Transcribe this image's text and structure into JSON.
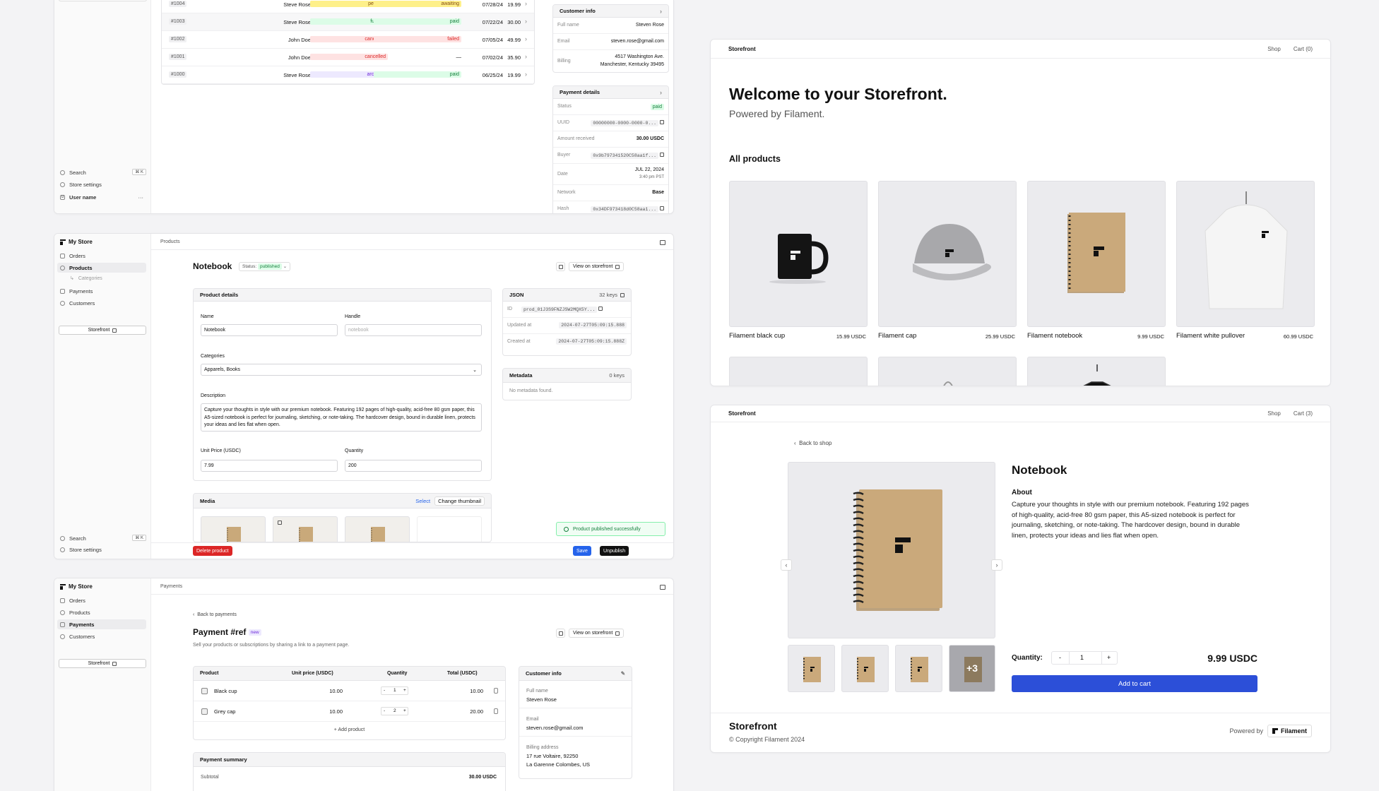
{
  "orders": {
    "rows": [
      {
        "id": "#1004",
        "customer": "Steve Rose",
        "status": "pending",
        "payment": "awaiting",
        "date": "07/28/24",
        "total": "19.99"
      },
      {
        "id": "#1003",
        "customer": "Steve Rose",
        "status": "fulfilled",
        "payment": "paid",
        "date": "07/22/24",
        "total": "30.00"
      },
      {
        "id": "#1002",
        "customer": "John Doe",
        "status": "cancelled",
        "payment": "failed",
        "date": "07/05/24",
        "total": "49.99"
      },
      {
        "id": "#1001",
        "customer": "John Doe",
        "status": "cancelled",
        "payment": "—",
        "date": "07/02/24",
        "total": "35.90"
      },
      {
        "id": "#1000",
        "customer": "Steve Rose",
        "status": "archived",
        "payment": "paid",
        "date": "06/25/24",
        "total": "19.99"
      }
    ],
    "sidebar": {
      "search": "Search",
      "shortcut": "⌘ K",
      "settings": "Store settings",
      "user": "User name",
      "user_initial": "U",
      "more": "···"
    },
    "customer": {
      "title": "Customer info",
      "full_name_label": "Full name",
      "full_name": "Steven Rose",
      "email_label": "Email",
      "email": "steven.rose@gmail.com",
      "billing_label": "Billing",
      "billing_1": "4517 Washington Ave.",
      "billing_2": "Manchester, Kentucky 39495"
    },
    "payment": {
      "title": "Payment details",
      "status_label": "Status",
      "status": "paid",
      "uuid_label": "UUID",
      "uuid": "00000000-0000-0000-0...",
      "amount_label": "Amount received",
      "amount": "30.00 USDC",
      "buyer_label": "Buyer",
      "buyer": "0x9b797341520C58aa1f...",
      "date_label": "Date",
      "date_1": "JUL 22, 2024",
      "date_2": "3:40 pm PST",
      "network_label": "Network",
      "network": "Base",
      "hash_label": "Hash",
      "hash": "0x34DF973418d0C58aa1..."
    }
  },
  "products_win": {
    "store": "My Store",
    "nav": [
      "Orders",
      "Products",
      "Categories",
      "Payments",
      "Customers"
    ],
    "storefront": "Storefront",
    "breadcrumb": "Products",
    "title": "Notebook",
    "status_label": "Status:",
    "status": "published",
    "view_storefront": "View on storefront",
    "details_title": "Product details",
    "name_label": "Name",
    "name": "Notebook",
    "handle_label": "Handle",
    "handle_placeholder": "notebook",
    "categories_label": "Categories",
    "categories": "Apparels, Books",
    "description_label": "Description",
    "description": "Capture your thoughts in style with our premium notebook. Featuring 192 pages of high-quality, acid-free 80 gsm paper, this A5-sized notebook is perfect for journaling, sketching, or note-taking. The hardcover design, bound in durable linen, protects your ideas and lies flat when open.",
    "price_label": "Unit Price (USDC)",
    "price": "7.99",
    "qty_label": "Quantity",
    "qty": "200",
    "json_title": "JSON",
    "json_keys": "32 keys",
    "id_label": "ID",
    "id": "prod_01J3S9FNZJSW2MQX5Y...",
    "updated_label": "Updated at",
    "updated": "2024-07-27T05:09:15.888",
    "created_label": "Created at",
    "created": "2024-07-27T05:09:15.888Z",
    "meta_title": "Metadata",
    "meta_keys": "0 keys",
    "meta_empty": "No metadata found.",
    "media_title": "Media",
    "select": "Select",
    "change_thumb": "Change thumbnail",
    "toast": "Product published successfully",
    "search": "Search",
    "shortcut": "⌘ K",
    "settings": "Store settings",
    "delete": "Delete product",
    "save": "Save",
    "unpublish": "Unpublish"
  },
  "payments_win": {
    "store": "My Store",
    "nav": [
      "Orders",
      "Products",
      "Payments",
      "Customers"
    ],
    "storefront": "Storefront",
    "breadcrumb": "Payments",
    "back": "Back to payments",
    "title": "Payment #ref",
    "badge": "new",
    "subtitle": "Sell your products or subscriptions by sharing a link to a payment page.",
    "view_storefront": "View on storefront",
    "cols": [
      "Product",
      "Unit price (USDC)",
      "Quantity",
      "Total (USDC)"
    ],
    "items": [
      {
        "name": "Black cup",
        "price": "10.00",
        "qty": "1",
        "total": "10.00"
      },
      {
        "name": "Grey cap",
        "price": "10.00",
        "qty": "2",
        "total": "20.00"
      }
    ],
    "add_product": "Add product",
    "summary_title": "Payment summary",
    "subtotal_label": "Subtotal",
    "subtotal": "30.00 USDC",
    "customer_title": "Customer info",
    "full_name_label": "Full name",
    "full_name": "Steven Rose",
    "email_label": "Email",
    "email": "steven.rose@gmail.com",
    "billing_label": "Billing address",
    "billing_1": "17 rue Voltaire, 92250",
    "billing_2": "La Garenne Colombes, US"
  },
  "shop": {
    "brand": "Storefront",
    "nav_shop": "Shop",
    "cart": "Cart (0)",
    "heading": "Welcome to your Storefront.",
    "sub": "Powered by Filament.",
    "section": "All products",
    "products": [
      {
        "name": "Filament black cup",
        "price": "15.99 USDC"
      },
      {
        "name": "Filament cap",
        "price": "25.99 USDC"
      },
      {
        "name": "Filament notebook",
        "price": "9.99 USDC"
      },
      {
        "name": "Filament white pullover",
        "price": "60.99 USDC"
      }
    ]
  },
  "pdp": {
    "brand": "Storefront",
    "nav_shop": "Shop",
    "cart": "Cart (3)",
    "back": "Back to shop",
    "title": "Notebook",
    "about": "About",
    "description": "Capture your thoughts in style with our premium notebook. Featuring 192 pages of high-quality, acid-free 80 gsm paper, this A5-sized notebook is perfect for journaling, sketching, or note-taking. The hardcover design, bound in durable linen, protects your ideas and lies flat when open.",
    "more": "+3",
    "qty_label": "Quantity:",
    "qty": "1",
    "minus": "-",
    "plus": "+",
    "price": "9.99 USDC",
    "add": "Add to cart",
    "footer_brand": "Storefront",
    "copyright": "© Copyright Filament 2024",
    "powered": "Powered by",
    "filament": "Filament"
  }
}
